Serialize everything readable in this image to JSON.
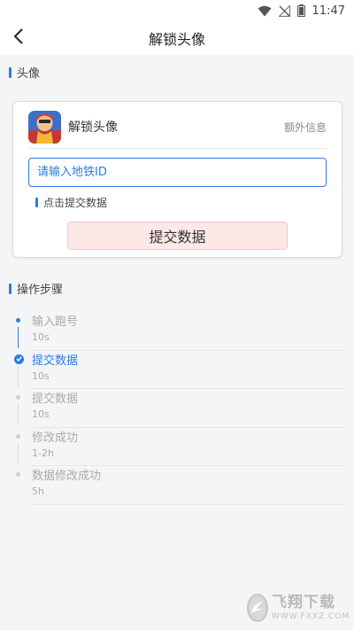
{
  "status_bar": {
    "time": "11:47"
  },
  "header": {
    "title": "解锁头像"
  },
  "section_avatar": {
    "title": "头像"
  },
  "card": {
    "app_name": "解锁头像",
    "extra_info": "额外信息",
    "input": {
      "value": "",
      "placeholder": "请输入地铁ID"
    },
    "hint": "点击提交数据",
    "submit_label": "提交数据"
  },
  "section_steps": {
    "title": "操作步骤"
  },
  "steps": [
    {
      "name": "输入跑号",
      "time": "10s",
      "state": "done"
    },
    {
      "name": "提交数据",
      "time": "10s",
      "state": "active"
    },
    {
      "name": "提交数据",
      "time": "10s",
      "state": "pending"
    },
    {
      "name": "修改成功",
      "time": "1-2h",
      "state": "pending"
    },
    {
      "name": "数据修改成功",
      "time": "5h",
      "state": "pending"
    }
  ],
  "watermark": {
    "text_cn": "飞翔下载",
    "text_en": "WWW.FXXZ.COM"
  },
  "colors": {
    "accent": "#2a7de1",
    "submit_bg": "#fde7e7",
    "page_bg": "#f4f5f7"
  }
}
